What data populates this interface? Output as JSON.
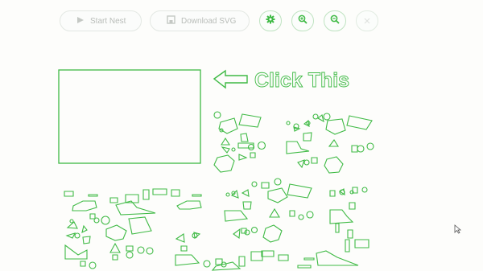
{
  "toolbar": {
    "start_label": "Start Nest",
    "download_label": "Download SVG",
    "settings_icon": "gear-icon",
    "zoom_in_icon": "zoom-in-icon",
    "zoom_out_icon": "zoom-out-icon",
    "close_icon": "close-icon"
  },
  "hint": {
    "text": "Click This",
    "arrow_icon": "arrow-left-icon"
  },
  "colors": {
    "accent": "#3fba45",
    "muted": "#b9bdb9"
  }
}
